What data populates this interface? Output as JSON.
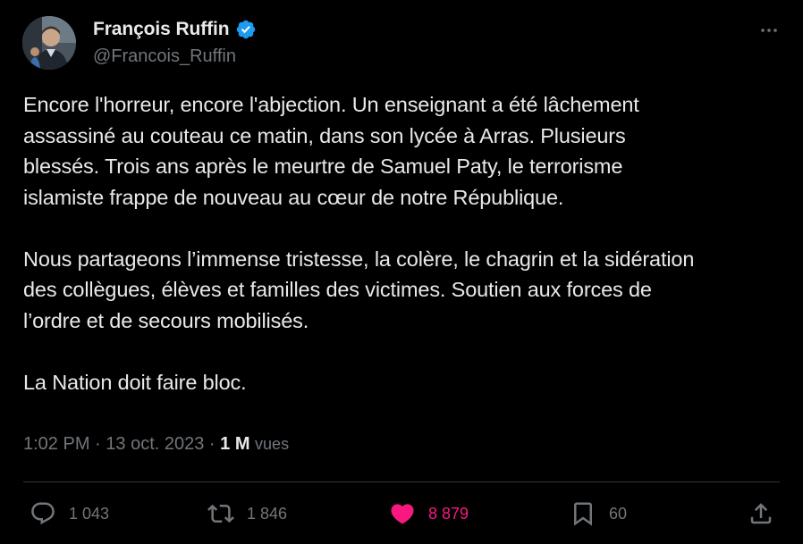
{
  "author": {
    "display_name": "François Ruffin",
    "handle": "@Francois_Ruffin",
    "verified": true,
    "avatar_icon": "profile-photo",
    "verified_icon": "verified-badge-icon"
  },
  "tweet": {
    "paragraphs": [
      [
        "Encore l'horreur, encore l'abjection. Un enseignant a été lâchement",
        "assassiné au couteau ce matin, dans son lycée à Arras. Plusieurs",
        "blessés. Trois ans après le meurtre de Samuel Paty, le terrorisme",
        "islamiste frappe de nouveau au cœur de notre République."
      ],
      [
        "Nous partageons l’immense tristesse, la colère, le chagrin et la sidération",
        "des collègues, élèves et familles des victimes. Soutien aux forces de",
        "l’ordre et de secours mobilisés."
      ],
      [
        "La Nation doit faire bloc."
      ]
    ]
  },
  "meta": {
    "time": "1:02 PM",
    "date": "13 oct. 2023",
    "separator": " · ",
    "views_count": "1 M",
    "views_label": "vues"
  },
  "actions": {
    "replies": {
      "count": "1 043",
      "icon": "reply-icon"
    },
    "reposts": {
      "count": "1 846",
      "icon": "repost-icon"
    },
    "likes": {
      "count": "8 879",
      "icon": "heart-icon",
      "liked": true
    },
    "bookmarks": {
      "count": "60",
      "icon": "bookmark-icon"
    },
    "share": {
      "icon": "share-icon"
    }
  },
  "colors": {
    "background": "#000000",
    "text_primary": "#e7e9ea",
    "text_secondary": "#71767b",
    "verified_blue": "#1d9bf0",
    "like_pink": "#f91880",
    "divider": "#2f3336"
  }
}
